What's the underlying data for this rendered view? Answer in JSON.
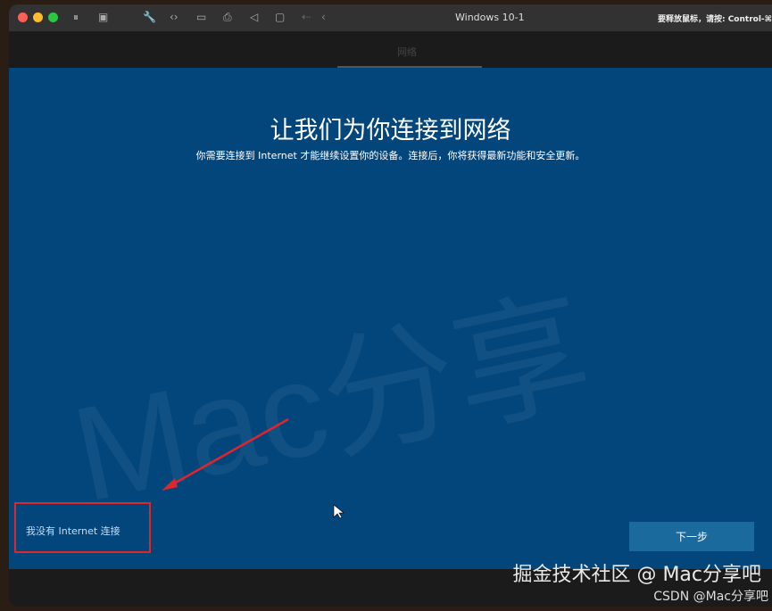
{
  "window": {
    "title": "Windows 10-1",
    "hint": "要释放鼠标，请按: Control-⌘"
  },
  "header": {
    "label": "网络"
  },
  "main": {
    "title": "让我们为你连接到网络",
    "subtitle": "你需要连接到 Internet 才能继续设置你的设备。连接后，你将获得最新功能和安全更新。",
    "no_internet_link": "我没有 Internet 连接",
    "next_button": "下一步"
  },
  "watermark": {
    "main": "掘金技术社区 @ Mac分享吧",
    "csdn": "CSDN @Mac分享吧",
    "diagonal": "Mac分享"
  },
  "colors": {
    "accent": "#03467c",
    "highlight": "#e0252b"
  }
}
